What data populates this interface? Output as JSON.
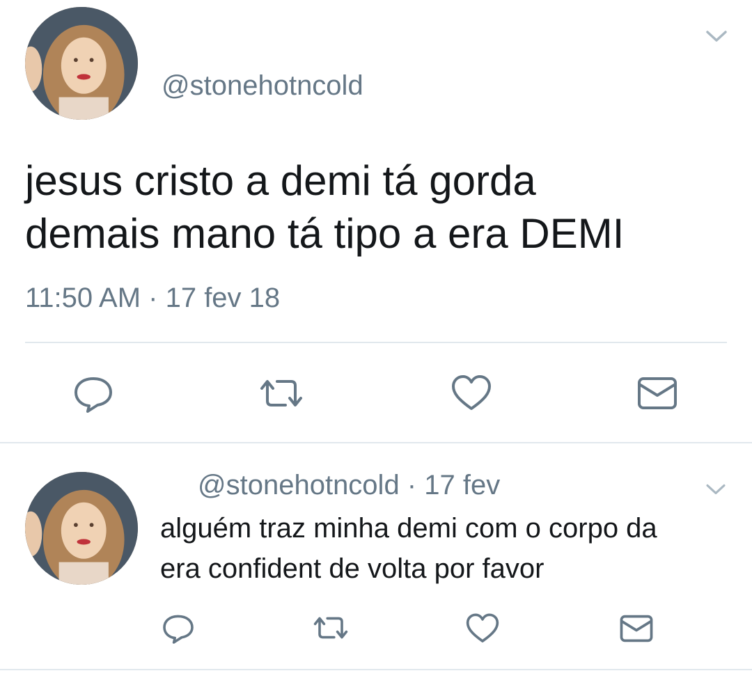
{
  "main_tweet": {
    "display_name": "",
    "handle": "@stonehotncold",
    "text_line1": "jesus cristo a demi tá gorda",
    "text_line2": "demais mano tá tipo a era DEMI",
    "timestamp": "11:50 AM · 17 fev 18",
    "actions": [
      "reply-icon",
      "retweet-icon",
      "like-icon",
      "dm-icon"
    ]
  },
  "reply_tweet": {
    "handle_and_date": "@stonehotncold · 17 fev",
    "text_line1": "alguém traz minha demi com o corpo da",
    "text_line2": "era confident de volta por favor",
    "actions": [
      "reply-icon",
      "retweet-icon",
      "like-icon",
      "dm-icon"
    ]
  },
  "colors": {
    "text": "#14171a",
    "muted": "#657786",
    "divider": "#e1e8ed"
  }
}
